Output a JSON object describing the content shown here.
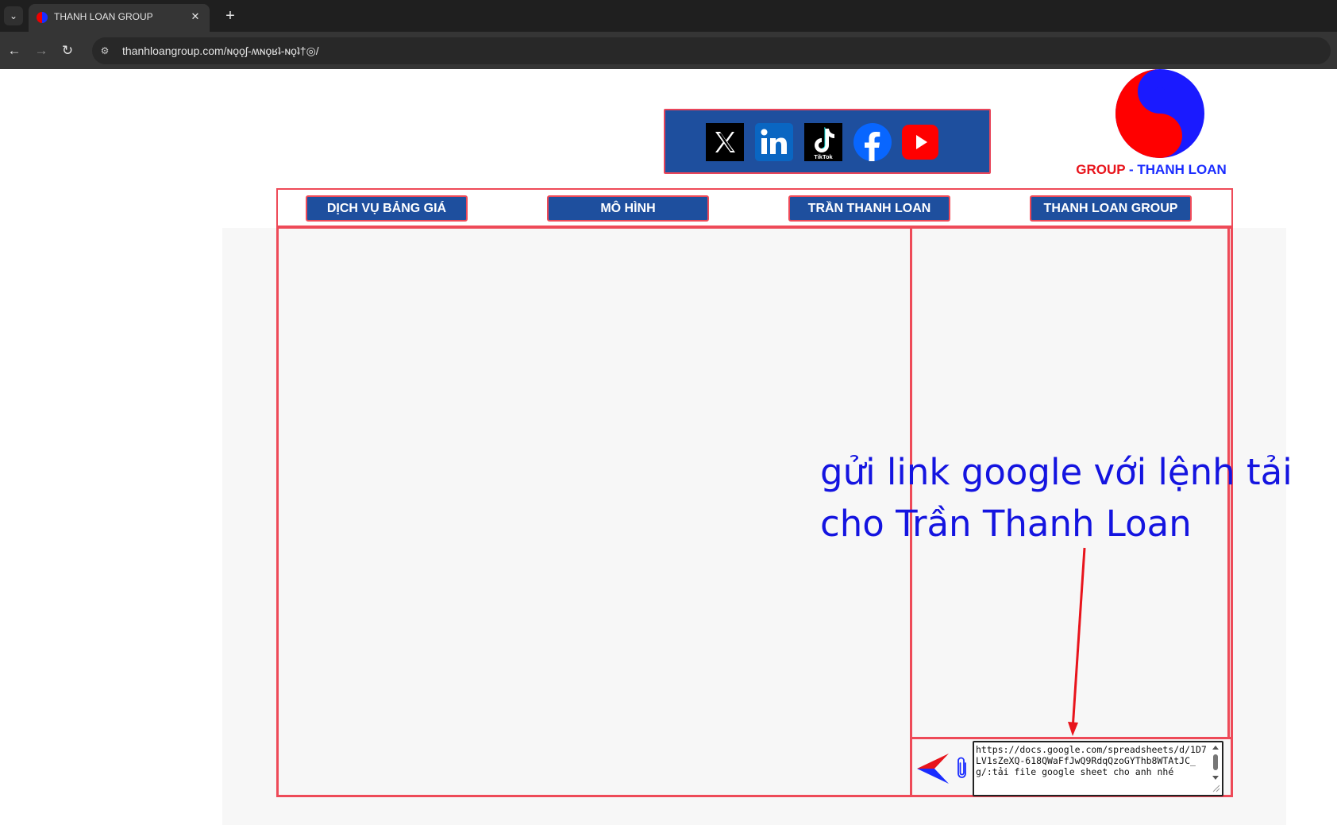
{
  "browser": {
    "tab_title": "THANH LOAN GROUP",
    "url": "thanhloangroup.com/ɴǫǫʃ-ʍɴǫʁʇ-ɴǫʇ†◎/"
  },
  "header": {
    "social_icons": [
      "x-icon",
      "linkedin-icon",
      "tiktok-icon",
      "facebook-icon",
      "youtube-icon"
    ],
    "tiktok_label": "TikTok",
    "logo": {
      "text_group": "GROUP",
      "text_sep": " - ",
      "text_name": "THANH LOAN"
    }
  },
  "nav": {
    "items": [
      {
        "label": "DỊCH VỤ BẢNG GIÁ"
      },
      {
        "label": "MÔ HÌNH"
      },
      {
        "label": "TRẦN THANH LOAN"
      },
      {
        "label": "THANH LOAN GROUP"
      }
    ]
  },
  "chat": {
    "message_value": "https://docs.google.com/spreadsheets/d/1D7LV1sZeXQ-618QWaFfJwQ9RdqQzoGYThb8WTAtJC_g/:tải file google sheet cho anh nhé"
  },
  "annotation": {
    "text": "gửi link google với lệnh tải cho Trần Thanh Loan"
  },
  "colors": {
    "brand_blue": "#1e4f9e",
    "border_red": "#ee4a58",
    "annotation_blue": "#1414e0",
    "arrow_red": "#e8141c"
  }
}
